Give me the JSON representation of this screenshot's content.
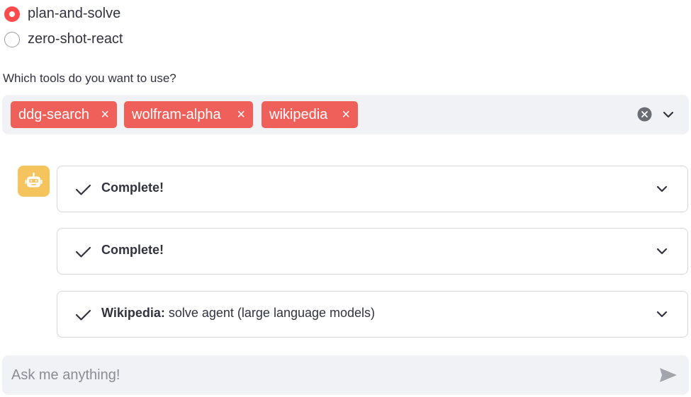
{
  "agent_type": {
    "options": [
      {
        "label": "plan-and-solve",
        "selected": true
      },
      {
        "label": "zero-shot-react",
        "selected": false
      }
    ]
  },
  "tools": {
    "label": "Which tools do you want to use?",
    "selected": [
      "ddg-search",
      "wolfram-alpha",
      "wikipedia"
    ],
    "remove_glyph": "×"
  },
  "chat": {
    "avatar_icon": "robot-icon",
    "steps": [
      {
        "status_icon": "check-icon",
        "title_bold": "Complete!",
        "title_rest": ""
      },
      {
        "status_icon": "check-icon",
        "title_bold": "Complete!",
        "title_rest": ""
      },
      {
        "status_icon": "check-icon",
        "title_bold": "Wikipedia:",
        "title_rest": " solve agent (large language models)"
      }
    ]
  },
  "chat_input": {
    "placeholder": "Ask me anything!",
    "value": ""
  },
  "colors": {
    "accent": "#ff4b4b",
    "chip": "#f0605a",
    "avatar": "#f6c45d",
    "input_bg": "#f0f2f6",
    "text": "#31333f"
  }
}
